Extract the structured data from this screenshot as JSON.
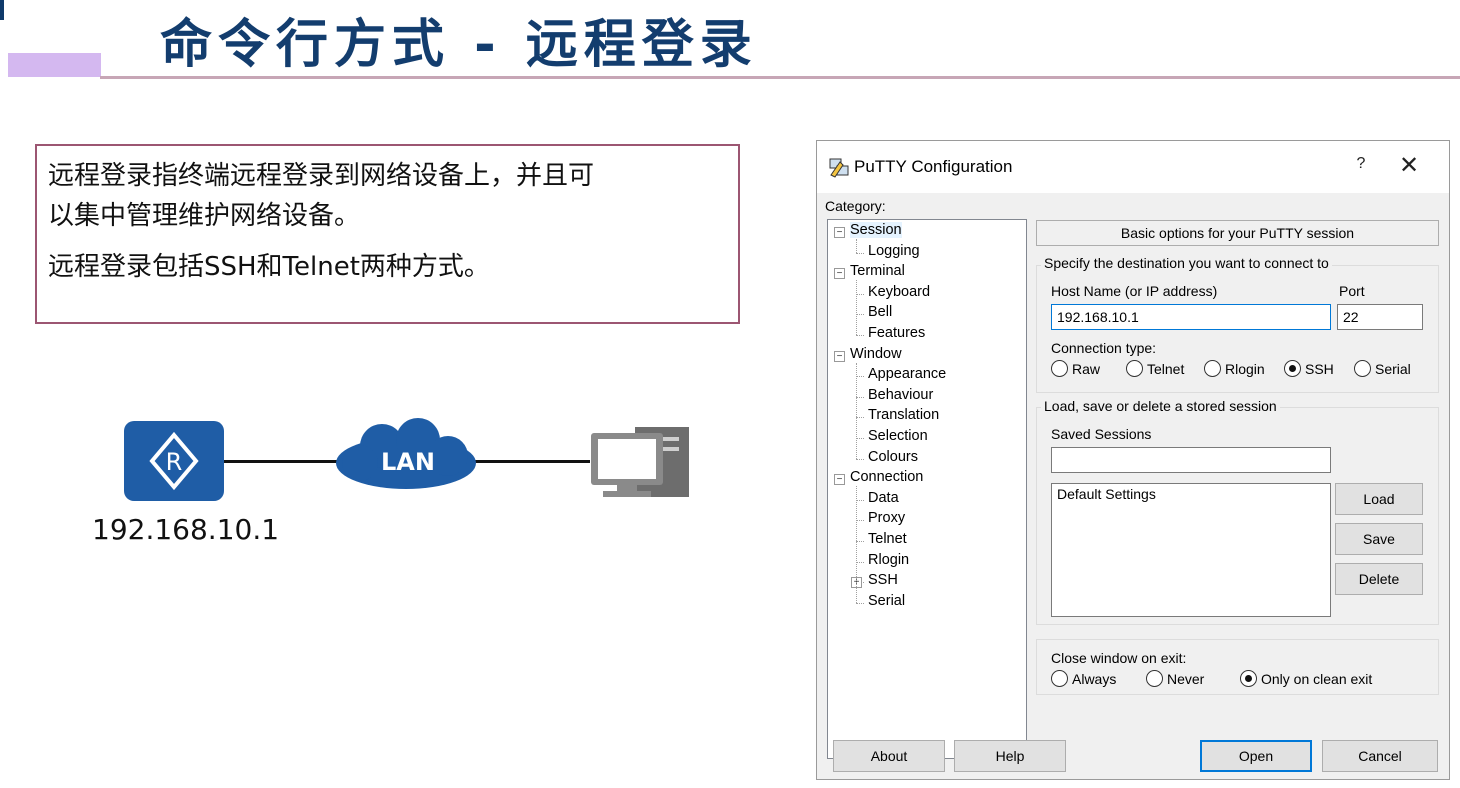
{
  "slide": {
    "title": "命令行方式 - 远程登录"
  },
  "info": {
    "line1": "远程登录指终端远程登录到网络设备上，并且可",
    "line2": "以集中管理维护网络设备。",
    "line3": "远程登录包括SSH和Telnet两种方式。"
  },
  "topology": {
    "router_letter": "R",
    "cloud_label": "LAN",
    "router_ip": "192.168.10.1",
    "router_color": "#1f5da6"
  },
  "putty": {
    "window_title": "PuTTY Configuration",
    "help_glyph": "?",
    "close_glyph": "✕",
    "category_label": "Category:",
    "tree": [
      {
        "label": "Session",
        "level": 0,
        "expander": "−",
        "selected": true
      },
      {
        "label": "Logging",
        "level": 1
      },
      {
        "label": "Terminal",
        "level": 0,
        "expander": "−"
      },
      {
        "label": "Keyboard",
        "level": 1
      },
      {
        "label": "Bell",
        "level": 1
      },
      {
        "label": "Features",
        "level": 1
      },
      {
        "label": "Window",
        "level": 0,
        "expander": "−"
      },
      {
        "label": "Appearance",
        "level": 1
      },
      {
        "label": "Behaviour",
        "level": 1
      },
      {
        "label": "Translation",
        "level": 1
      },
      {
        "label": "Selection",
        "level": 1
      },
      {
        "label": "Colours",
        "level": 1
      },
      {
        "label": "Connection",
        "level": 0,
        "expander": "−"
      },
      {
        "label": "Data",
        "level": 1
      },
      {
        "label": "Proxy",
        "level": 1
      },
      {
        "label": "Telnet",
        "level": 1
      },
      {
        "label": "Rlogin",
        "level": 1
      },
      {
        "label": "SSH",
        "level": 1,
        "expander": "+"
      },
      {
        "label": "Serial",
        "level": 1
      }
    ],
    "panel_heading": "Basic options for your PuTTY session",
    "destination_group": "Specify the destination you want to connect to",
    "host_label": "Host Name (or IP address)",
    "host_value": "192.168.10.1",
    "port_label": "Port",
    "port_value": "22",
    "conn_type_label": "Connection type:",
    "conn_types": [
      {
        "label": "Raw",
        "checked": false
      },
      {
        "label": "Telnet",
        "checked": false
      },
      {
        "label": "Rlogin",
        "checked": false
      },
      {
        "label": "SSH",
        "checked": true
      },
      {
        "label": "Serial",
        "checked": false
      }
    ],
    "sessions_group": "Load, save or delete a stored session",
    "saved_sessions_label": "Saved Sessions",
    "saved_sessions_value": "",
    "sessions_list": [
      "Default Settings"
    ],
    "load_label": "Load",
    "save_label": "Save",
    "delete_label": "Delete",
    "close_on_exit_label": "Close window on exit:",
    "exit_options": [
      {
        "label": "Always",
        "checked": false
      },
      {
        "label": "Never",
        "checked": false
      },
      {
        "label": "Only on clean exit",
        "checked": true
      }
    ],
    "about_label": "About",
    "help_label": "Help",
    "open_label": "Open",
    "cancel_label": "Cancel"
  }
}
